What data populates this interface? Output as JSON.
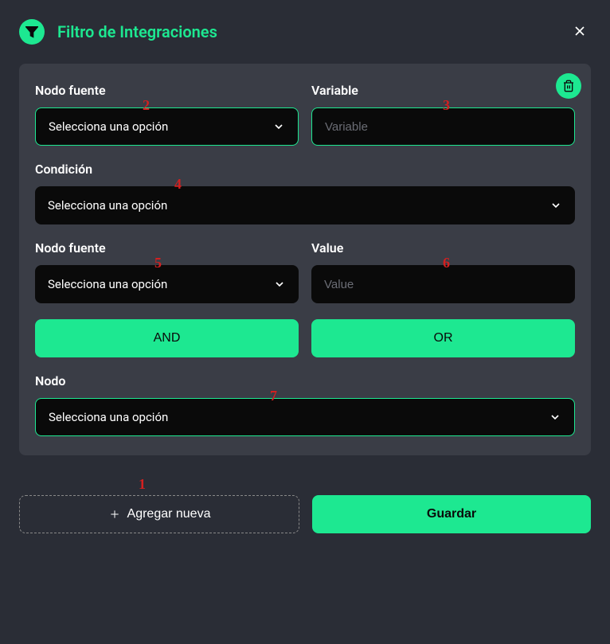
{
  "header": {
    "title": "Filtro de Integraciones"
  },
  "card": {
    "field1": {
      "label": "Nodo fuente",
      "placeholder": "Selecciona una opción"
    },
    "field2": {
      "label": "Variable",
      "placeholder": "Variable"
    },
    "field3": {
      "label": "Condición",
      "placeholder": "Selecciona una opción"
    },
    "field4": {
      "label": "Nodo fuente",
      "placeholder": "Selecciona una opción"
    },
    "field5": {
      "label": "Value",
      "placeholder": "Value"
    },
    "logic": {
      "and": "AND",
      "or": "OR"
    },
    "field6": {
      "label": "Nodo",
      "placeholder": "Selecciona una opción"
    }
  },
  "footer": {
    "addButton": "Agregar nueva",
    "saveButton": "Guardar"
  },
  "annotations": {
    "a1": "1",
    "a2": "2",
    "a3": "3",
    "a4": "4",
    "a5": "5",
    "a6": "6",
    "a7": "7"
  }
}
